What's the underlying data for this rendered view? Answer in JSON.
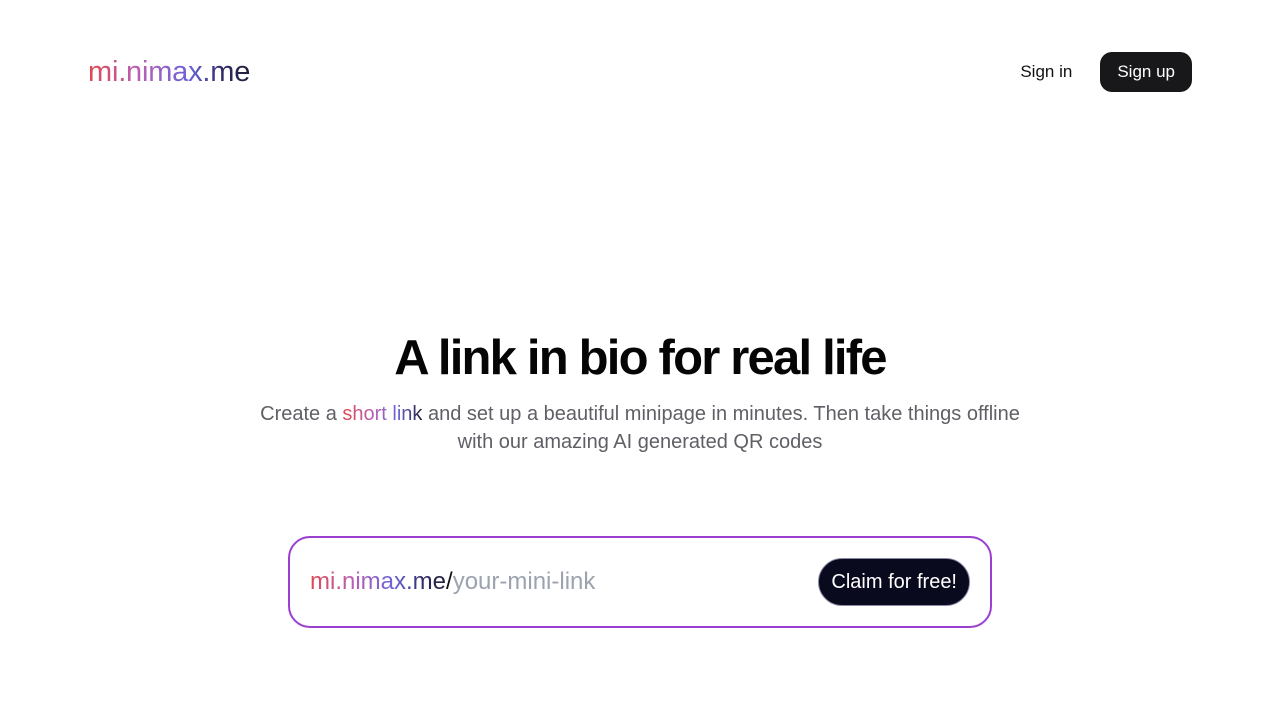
{
  "header": {
    "logo": "mi.nimax.me",
    "sign_in": "Sign in",
    "sign_up": "Sign up"
  },
  "hero": {
    "title": "A link in bio for real life",
    "subtitle_before": "Create a ",
    "subtitle_highlight": "short link",
    "subtitle_after": " and set up a beautiful minipage in minutes. Then take things offline with our amazing AI generated QR codes"
  },
  "claim": {
    "domain": "mi.nimax.me",
    "slash": "/",
    "input_value": "",
    "placeholder": "your-mini-link",
    "button_label": "Claim for free!",
    "border_color": "#9b3fd0"
  },
  "colors": {
    "brand_gradient": [
      "#e0484f",
      "#b85fb6",
      "#6a63d8",
      "#1f1f3a"
    ],
    "primary_button": "#18181b",
    "claim_button": "#0a0a1f"
  }
}
